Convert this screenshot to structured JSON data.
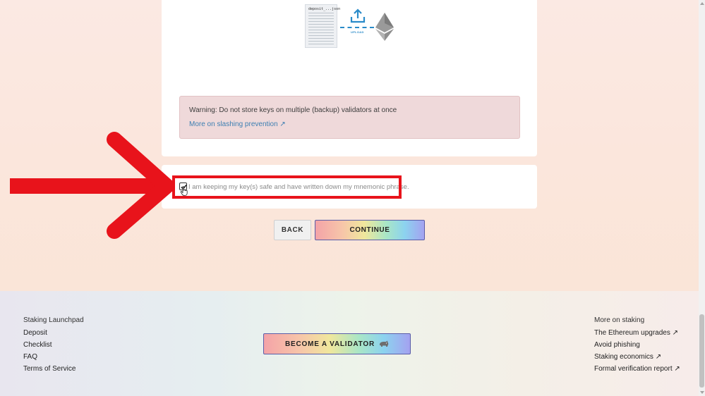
{
  "illustration": {
    "file_name": "deposit_...json",
    "upload_label": "UPLOAD"
  },
  "warning": {
    "text": "Warning: Do not store keys on multiple (backup) validators at once",
    "link": "More on slashing prevention ↗"
  },
  "confirmation": {
    "label": "I am keeping my key(s) safe and have written down my mnemonic phrase.",
    "checked": true
  },
  "buttons": {
    "back": "BACK",
    "continue": "CONTINUE",
    "become_validator": "BECOME A VALIDATOR"
  },
  "footer": {
    "left": {
      "heading": "Staking Launchpad",
      "links": [
        "Deposit",
        "Checklist",
        "FAQ",
        "Terms of Service"
      ]
    },
    "right": {
      "heading": "More on staking",
      "links": [
        "The Ethereum upgrades ↗",
        "Avoid phishing",
        "Staking economics ↗",
        "Formal verification report ↗"
      ]
    }
  },
  "colors": {
    "highlight": "#e8131b",
    "link": "#3d7fb2",
    "warning_bg": "#efd9da"
  },
  "icons": [
    "upload-arrow-icon",
    "ethereum-icon",
    "checkmark-icon",
    "hand-cursor-icon",
    "red-arrow-icon",
    "rhino-icon"
  ]
}
